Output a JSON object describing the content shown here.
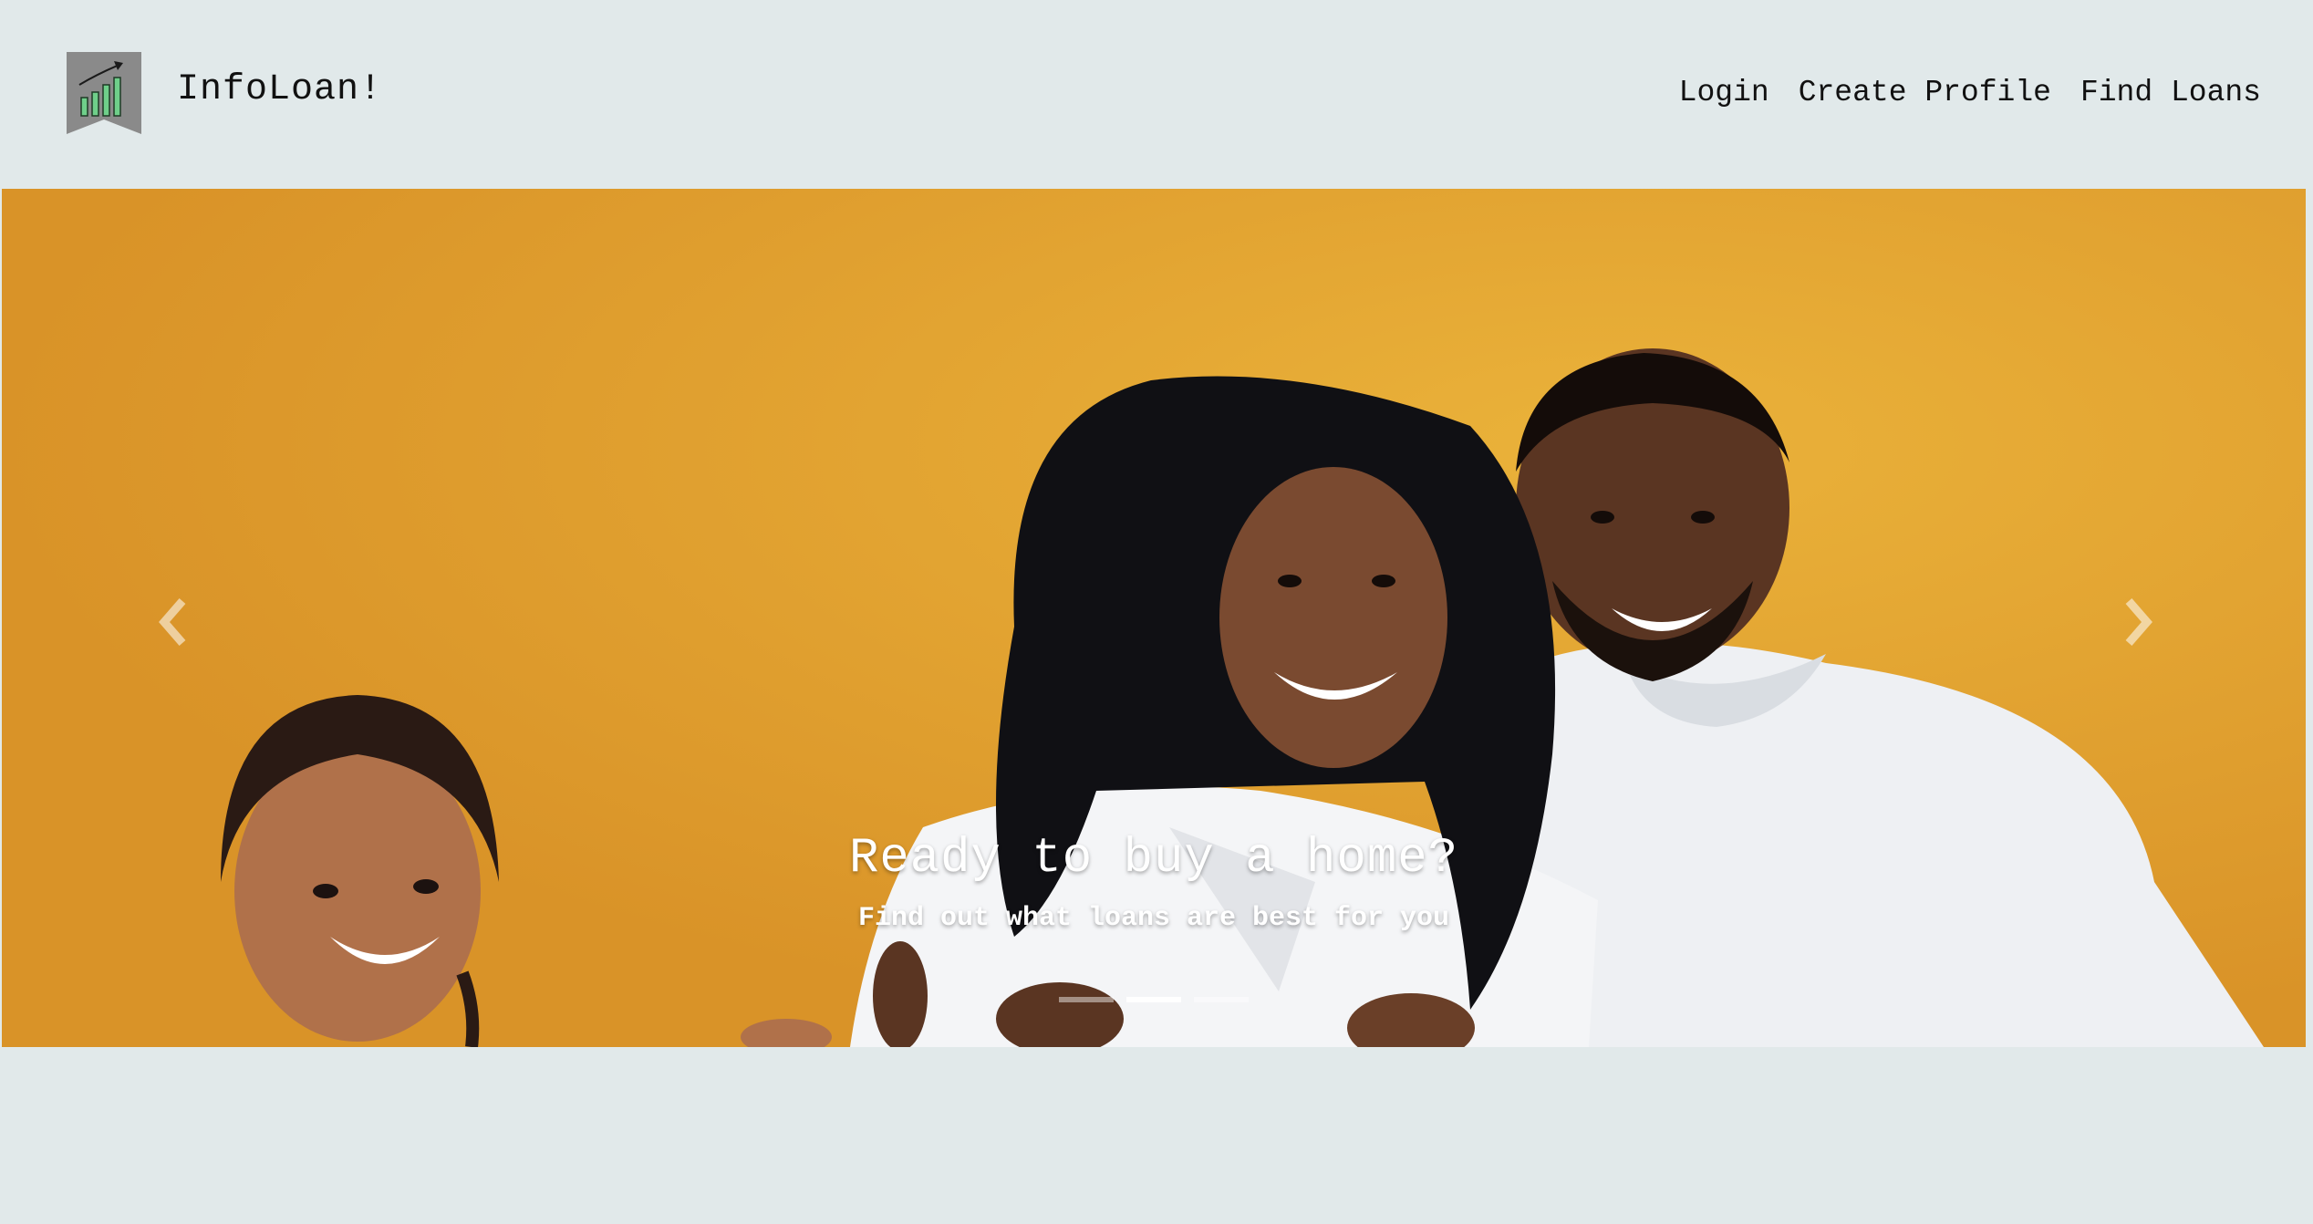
{
  "header": {
    "brand": "InfoLoan!",
    "logo_icon": "bar-chart-growth-icon",
    "nav": [
      {
        "label": "Login"
      },
      {
        "label": "Create Profile"
      },
      {
        "label": "Find Loans"
      }
    ]
  },
  "carousel": {
    "slide_title": "Ready to buy a home?",
    "slide_subtitle": "Find out what loans are best for you",
    "indicators": 3,
    "active_indicator": 2,
    "prev_icon": "chevron-left-icon",
    "next_icon": "chevron-right-icon",
    "image_description": "smiling family against a yellow background"
  },
  "colors": {
    "page_background": "#e1e9ea",
    "hero_background": "#e3a22c",
    "logo_background": "#8a8a8a",
    "logo_bars": "#6fcf8a"
  }
}
